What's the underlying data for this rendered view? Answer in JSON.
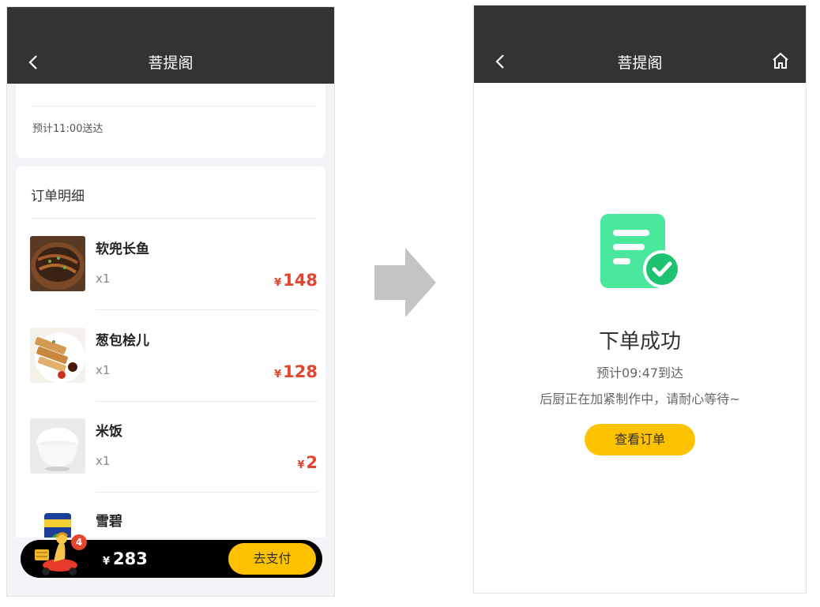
{
  "left": {
    "nav": {
      "title": "菩提阁"
    },
    "delivery": {
      "eta": "预计11:00送达"
    },
    "order": {
      "section_title": "订单明细",
      "items": [
        {
          "name": "软兜长鱼",
          "qty": "x1",
          "currency": "¥",
          "price": "148"
        },
        {
          "name": "葱包桧儿",
          "qty": "x1",
          "currency": "¥",
          "price": "128"
        },
        {
          "name": "米饭",
          "qty": "x1",
          "currency": "¥",
          "price": "2"
        },
        {
          "name": "雪碧"
        }
      ]
    },
    "cart": {
      "badge": "4",
      "currency": "¥",
      "total": "283",
      "pay_label": "去支付"
    }
  },
  "right": {
    "nav": {
      "title": "菩提阁"
    },
    "success": {
      "title": "下单成功",
      "eta": "预计09:47到达",
      "message": "后厨正在加紧制作中，请耐心等待~",
      "button_label": "查看订单"
    }
  },
  "colors": {
    "nav_bg": "#333333",
    "accent": "#ffc200",
    "price": "#e4452f",
    "success_green": "#4ae89e"
  }
}
